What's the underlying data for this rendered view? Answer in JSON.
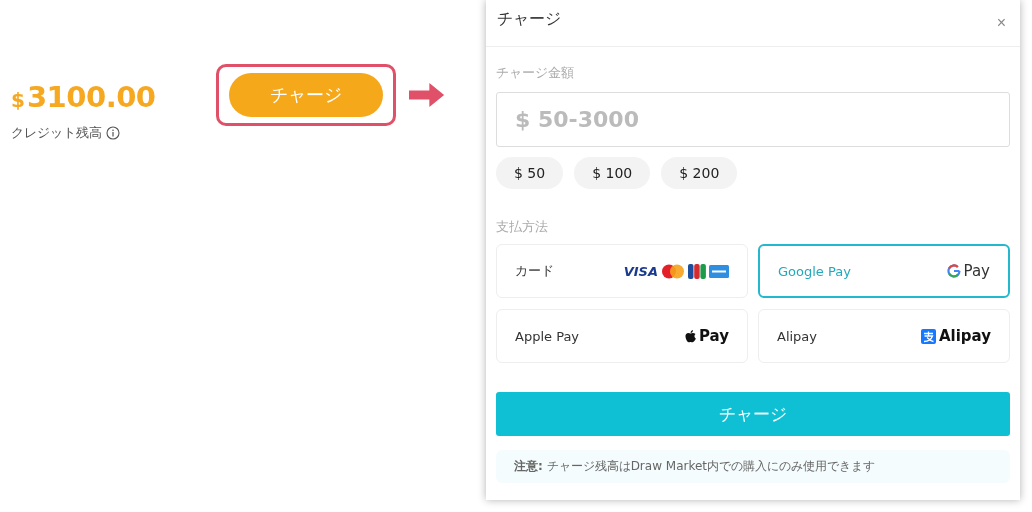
{
  "balance": {
    "currency": "$",
    "amount": "3100.00",
    "label": "クレジット残高"
  },
  "charge_button": {
    "label": "チャージ"
  },
  "dialog": {
    "title": "チャージ",
    "close": "×",
    "amount_label": "チャージ金額",
    "amount_field": {
      "placeholder": "$ 50-3000"
    },
    "presets": [
      {
        "label": "$ 50",
        "selected": false
      },
      {
        "label": "$ 100",
        "selected": false
      },
      {
        "label": "$ 200",
        "selected": false
      }
    ],
    "method_label": "支払方法",
    "methods": [
      {
        "kind": "card",
        "label": "カード",
        "logo_text": "VISA",
        "selected": false
      },
      {
        "kind": "google",
        "label": "Google Pay",
        "logo_text": "Pay",
        "selected": true
      },
      {
        "kind": "apple",
        "label": "Apple Pay",
        "logo_text": "Pay",
        "selected": false
      },
      {
        "kind": "alipay",
        "label": "Alipay",
        "logo_text": "Alipay",
        "selected": false
      }
    ],
    "submit": "チャージ",
    "note": "**注意:** チャージ残高はDraw Market内での購入にのみ使用できます"
  }
}
